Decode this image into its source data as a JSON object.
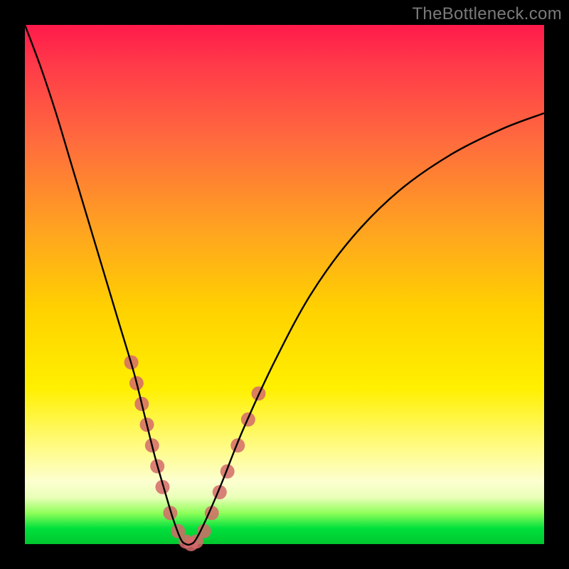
{
  "watermark": "TheBottleneck.com",
  "chart_data": {
    "type": "line",
    "title": "",
    "xlabel": "",
    "ylabel": "",
    "xlim": [
      0,
      100
    ],
    "ylim": [
      0,
      100
    ],
    "grid": false,
    "legend": false,
    "annotations": [],
    "series": [
      {
        "name": "bottleneck-curve",
        "color": "#000000",
        "x": [
          0,
          3,
          6,
          9,
          12,
          15,
          18,
          21,
          23,
          25,
          27,
          28.5,
          30,
          31,
          32,
          33,
          35,
          38,
          42,
          48,
          55,
          63,
          72,
          82,
          92,
          100
        ],
        "y": [
          100,
          92,
          83,
          73,
          63,
          53,
          43,
          33,
          25,
          17,
          10,
          5,
          1,
          0,
          0,
          1,
          5,
          12,
          22,
          35,
          48,
          59,
          68,
          75,
          80,
          83
        ]
      }
    ],
    "markers": [
      {
        "name": "highlight-dots",
        "color": "#d46a6a",
        "radius_px": 10,
        "points": [
          [
            20.5,
            35
          ],
          [
            21.5,
            31
          ],
          [
            22.5,
            27
          ],
          [
            23.5,
            23
          ],
          [
            24.5,
            19
          ],
          [
            25.5,
            15
          ],
          [
            26.5,
            11
          ],
          [
            28,
            6
          ],
          [
            29.5,
            2.5
          ],
          [
            31,
            0.5
          ],
          [
            32,
            0
          ],
          [
            33,
            0.5
          ],
          [
            34.5,
            2.5
          ],
          [
            36,
            6
          ],
          [
            37.5,
            10
          ],
          [
            39,
            14
          ],
          [
            41,
            19
          ],
          [
            43,
            24
          ],
          [
            45,
            29
          ]
        ]
      }
    ]
  }
}
